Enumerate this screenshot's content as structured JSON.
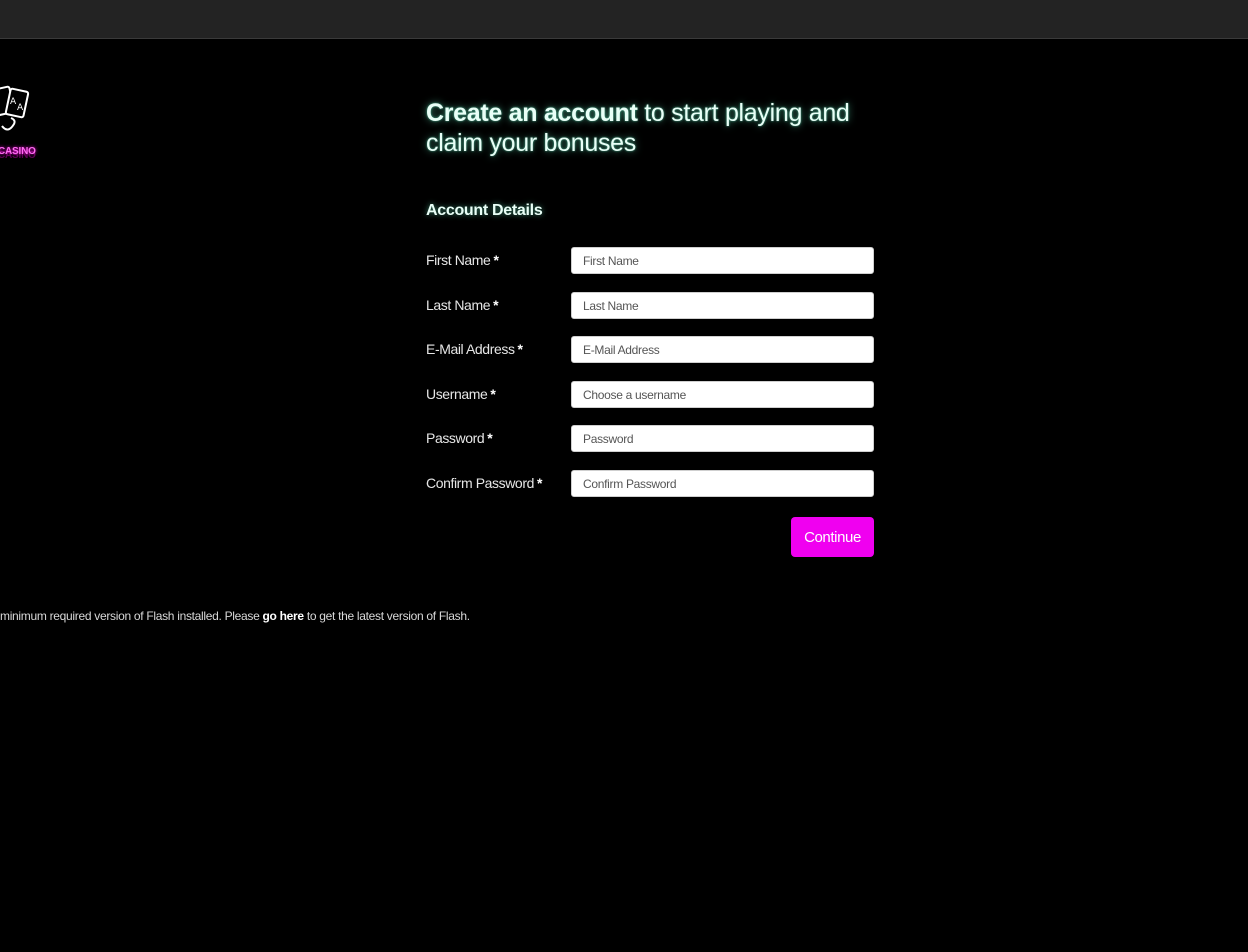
{
  "brand": {
    "logo_text": "CASINO",
    "accent_color": "#f000f0",
    "glow_color": "#6effd2"
  },
  "header": {
    "headline_strong": "Create an account",
    "headline_rest": " to start playing and claim your bonuses"
  },
  "form": {
    "section_title": "Account Details",
    "required_marker": "*",
    "fields": [
      {
        "label": "First Name",
        "placeholder": "First Name",
        "value": ""
      },
      {
        "label": "Last Name",
        "placeholder": "Last Name",
        "value": ""
      },
      {
        "label": "E-Mail Address",
        "placeholder": "E-Mail Address",
        "value": ""
      },
      {
        "label": "Username",
        "placeholder": "Choose a username",
        "value": ""
      },
      {
        "label": "Password",
        "placeholder": "Password",
        "value": ""
      },
      {
        "label": "Confirm Password",
        "placeholder": "Confirm Password",
        "value": ""
      }
    ],
    "submit_label": "Continue"
  },
  "flash_notice": {
    "prefix": "minimum required version of Flash installed. Please ",
    "link_text": "go here",
    "suffix": " to get the latest version of Flash."
  }
}
